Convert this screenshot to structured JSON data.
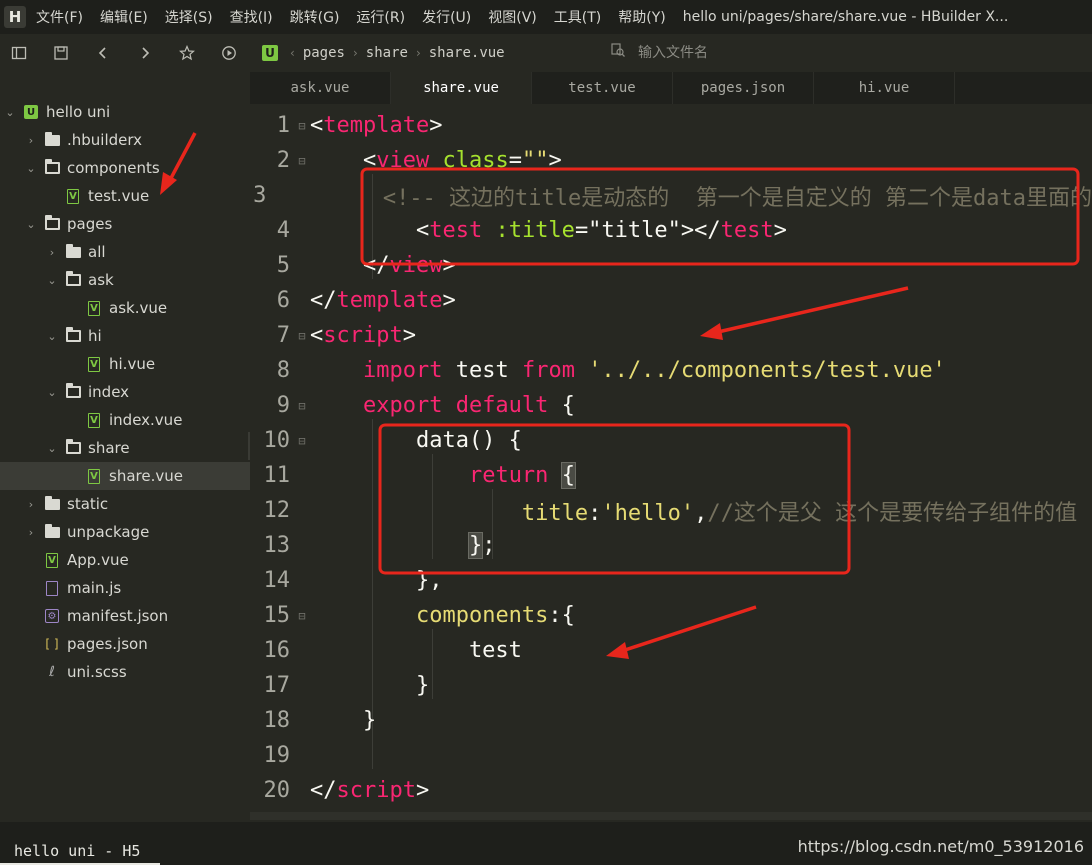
{
  "app": {
    "logo": "H",
    "window_title": "hello uni/pages/share/share.vue - HBuilder X..."
  },
  "menu": [
    "文件(F)",
    "编辑(E)",
    "选择(S)",
    "查找(I)",
    "跳转(G)",
    "运行(R)",
    "发行(U)",
    "视图(V)",
    "工具(T)",
    "帮助(Y)"
  ],
  "toolbar": {
    "icons": [
      "sidebar-toggle-icon",
      "save-icon",
      "back-icon",
      "forward-icon",
      "star-icon",
      "run-icon"
    ],
    "breadcrumb": [
      "pages",
      "share",
      "share.vue"
    ],
    "breadcrumb_badge": "U",
    "search_placeholder": "输入文件名"
  },
  "tree": [
    {
      "label": "hello uni",
      "depth": 0,
      "kind": "project",
      "chev": "v"
    },
    {
      "label": ".hbuilderx",
      "depth": 1,
      "kind": "folder",
      "chev": ">"
    },
    {
      "label": "components",
      "depth": 1,
      "kind": "folder-open",
      "chev": "v"
    },
    {
      "label": "test.vue",
      "depth": 2,
      "kind": "vue",
      "chev": ""
    },
    {
      "label": "pages",
      "depth": 1,
      "kind": "folder-open",
      "chev": "v"
    },
    {
      "label": "all",
      "depth": 2,
      "kind": "folder",
      "chev": ">"
    },
    {
      "label": "ask",
      "depth": 2,
      "kind": "folder-open",
      "chev": "v"
    },
    {
      "label": "ask.vue",
      "depth": 3,
      "kind": "vue",
      "chev": ""
    },
    {
      "label": "hi",
      "depth": 2,
      "kind": "folder-open",
      "chev": "v"
    },
    {
      "label": "hi.vue",
      "depth": 3,
      "kind": "vue",
      "chev": ""
    },
    {
      "label": "index",
      "depth": 2,
      "kind": "folder-open",
      "chev": "v"
    },
    {
      "label": "index.vue",
      "depth": 3,
      "kind": "vue",
      "chev": ""
    },
    {
      "label": "share",
      "depth": 2,
      "kind": "folder-open",
      "chev": "v"
    },
    {
      "label": "share.vue",
      "depth": 3,
      "kind": "vue",
      "chev": "",
      "selected": true
    },
    {
      "label": "static",
      "depth": 1,
      "kind": "folder",
      "chev": ">"
    },
    {
      "label": "unpackage",
      "depth": 1,
      "kind": "folder",
      "chev": ">"
    },
    {
      "label": "App.vue",
      "depth": 1,
      "kind": "vue",
      "chev": ""
    },
    {
      "label": "main.js",
      "depth": 1,
      "kind": "js",
      "chev": ""
    },
    {
      "label": "manifest.json",
      "depth": 1,
      "kind": "manifest",
      "chev": ""
    },
    {
      "label": "pages.json",
      "depth": 1,
      "kind": "json",
      "chev": ""
    },
    {
      "label": "uni.scss",
      "depth": 1,
      "kind": "scss",
      "chev": ""
    }
  ],
  "collapse_glyph": "‹",
  "tabs": [
    {
      "label": "ask.vue",
      "active": false
    },
    {
      "label": "share.vue",
      "active": true
    },
    {
      "label": "test.vue",
      "active": false
    },
    {
      "label": "pages.json",
      "active": false
    },
    {
      "label": "hi.vue",
      "active": false
    }
  ],
  "code": [
    {
      "n": "1",
      "fold": "⊟",
      "tokens": [
        [
          "punct",
          "<"
        ],
        [
          "tag",
          "template"
        ],
        [
          "punct",
          ">"
        ]
      ]
    },
    {
      "n": "2",
      "fold": "⊟",
      "tokens": [
        [
          "punct",
          "    <"
        ],
        [
          "tag",
          "view"
        ],
        [
          "punct",
          " "
        ],
        [
          "attr",
          "class"
        ],
        [
          "punct",
          "="
        ],
        [
          "str",
          "\"\""
        ],
        [
          "punct",
          ">"
        ]
      ]
    },
    {
      "n": "3",
      "fold": "",
      "tokens": [
        [
          "comment",
          "        <!-- 这边的title是动态的  第一个是自定义的 第二个是data里面的"
        ]
      ]
    },
    {
      "n": "4",
      "fold": "",
      "tokens": [
        [
          "punct",
          "        <"
        ],
        [
          "tag",
          "test"
        ],
        [
          "punct",
          " "
        ],
        [
          "attr",
          ":title"
        ],
        [
          "punct",
          "=\""
        ],
        [
          "ident",
          "title"
        ],
        [
          "punct",
          "\"></"
        ],
        [
          "tag",
          "test"
        ],
        [
          "punct",
          ">"
        ]
      ]
    },
    {
      "n": "5",
      "fold": "",
      "tokens": [
        [
          "punct",
          "    </"
        ],
        [
          "tag",
          "view"
        ],
        [
          "punct",
          ">"
        ]
      ]
    },
    {
      "n": "6",
      "fold": "",
      "tokens": [
        [
          "punct",
          "</"
        ],
        [
          "tag",
          "template"
        ],
        [
          "punct",
          ">"
        ]
      ]
    },
    {
      "n": "7",
      "fold": "⊟",
      "tokens": [
        [
          "punct",
          "<"
        ],
        [
          "tag",
          "script"
        ],
        [
          "punct",
          ">"
        ]
      ]
    },
    {
      "n": "8",
      "fold": "",
      "tokens": [
        [
          "punct",
          "    "
        ],
        [
          "kw",
          "import"
        ],
        [
          "ident",
          " test "
        ],
        [
          "kw",
          "from"
        ],
        [
          "punct",
          " "
        ],
        [
          "str",
          "'../../components/test.vue'"
        ]
      ]
    },
    {
      "n": "9",
      "fold": "⊟",
      "tokens": [
        [
          "punct",
          "    "
        ],
        [
          "kw",
          "export default"
        ],
        [
          "punct",
          " {"
        ]
      ]
    },
    {
      "n": "10",
      "fold": "⊟",
      "tokens": [
        [
          "ident",
          "        data() {"
        ]
      ]
    },
    {
      "n": "11",
      "fold": "",
      "tokens": [
        [
          "punct",
          "            "
        ],
        [
          "kw",
          "return"
        ],
        [
          "punct",
          " "
        ],
        [
          "hl",
          "{"
        ]
      ]
    },
    {
      "n": "12",
      "fold": "",
      "tokens": [
        [
          "punct",
          "                "
        ],
        [
          "prop",
          "title"
        ],
        [
          "punct",
          ":"
        ],
        [
          "str",
          "'hello'"
        ],
        [
          "punct",
          ","
        ],
        [
          "comment",
          "//这个是父 这个是要传给子组件的值"
        ]
      ]
    },
    {
      "n": "13",
      "fold": "",
      "tokens": [
        [
          "punct",
          "            "
        ],
        [
          "hl",
          "}"
        ],
        [
          "punct",
          ";"
        ]
      ]
    },
    {
      "n": "14",
      "fold": "",
      "tokens": [
        [
          "punct",
          "        },"
        ]
      ]
    },
    {
      "n": "15",
      "fold": "⊟",
      "tokens": [
        [
          "punct",
          "        "
        ],
        [
          "prop",
          "components"
        ],
        [
          "punct",
          ":{"
        ]
      ]
    },
    {
      "n": "16",
      "fold": "",
      "tokens": [
        [
          "ident",
          "            test"
        ]
      ]
    },
    {
      "n": "17",
      "fold": "",
      "tokens": [
        [
          "punct",
          "        }"
        ]
      ]
    },
    {
      "n": "18",
      "fold": "",
      "tokens": [
        [
          "punct",
          "    }"
        ]
      ]
    },
    {
      "n": "19",
      "fold": "",
      "tokens": []
    },
    {
      "n": "20",
      "fold": "",
      "tokens": [
        [
          "punct",
          "</"
        ],
        [
          "tag",
          "script"
        ],
        [
          "punct",
          ">"
        ]
      ]
    }
  ],
  "status": {
    "project": "hello uni - H5",
    "watermark": "https://blog.csdn.net/m0_53912016"
  },
  "colors": {
    "annotation": "#e8261c",
    "tag": "#f92672",
    "attr": "#a6e22e",
    "string": "#e6db74",
    "comment": "#75715e"
  }
}
